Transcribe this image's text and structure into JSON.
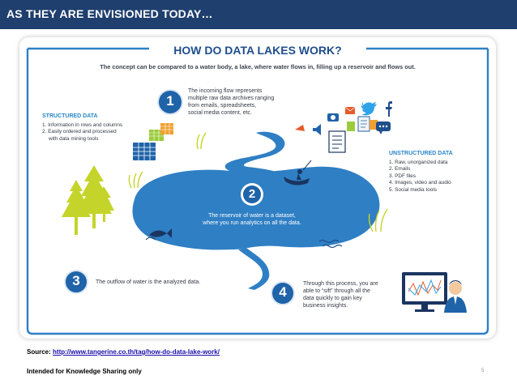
{
  "header": {
    "title": "AS THEY ARE ENVISIONED TODAY…",
    "bar_color": "#1f3f6e"
  },
  "infographic": {
    "title": "HOW DO DATA LAKES WORK?",
    "subtitle": "The concept can be compared to a water body, a lake, where water flows in, filling up a reservoir and flows out.",
    "steps": [
      {
        "number": "1",
        "lines": [
          "The incoming flow represents",
          "multiple raw data archives ranging",
          "from emails, spreadsheets,",
          "social media content, etc."
        ]
      },
      {
        "number": "2",
        "lines": [
          "The reservoir of water is a dataset,",
          "where you run analytics on all the data."
        ]
      },
      {
        "number": "3",
        "lines": [
          "The outflow of water is the analyzed data."
        ]
      },
      {
        "number": "4",
        "lines": [
          "Through this process, you are",
          "able to “sift” through all the",
          "data quickly to gain key",
          "business insights."
        ]
      }
    ],
    "structured": {
      "title": "STRUCTURED DATA",
      "items": [
        "1. Information in rows and columns",
        "2. Easily ordered and processed",
        "with data mining tools"
      ]
    },
    "unstructured": {
      "title": "UNSTRUCTURED DATA",
      "items": [
        "1. Raw, unorganized data",
        "2. Emails",
        "3. PDF files",
        "4. Images, video and audio",
        "5. Social media tools"
      ]
    },
    "colors": {
      "lake": "#2f7fc4",
      "stream": "#2f7fc4",
      "number_circle": "#1f63a8",
      "tree": "#c5d42a",
      "accent_title": "#1f4e8c"
    },
    "icons": [
      "boat-icon",
      "fish-icon",
      "trees-icon",
      "spreadsheet-icon",
      "camera-icon",
      "twitter-icon",
      "facebook-icon",
      "email-icon",
      "document-icon",
      "chat-icon",
      "speaker-icon",
      "computer-monitor-icon",
      "analyst-person-icon"
    ]
  },
  "footer": {
    "source_label": "Source:",
    "source_url": "http://www.tangerine.co.th/tag/how-do-data-lake-work/",
    "note": "Intended for Knowledge Sharing only",
    "page_number": "5"
  }
}
